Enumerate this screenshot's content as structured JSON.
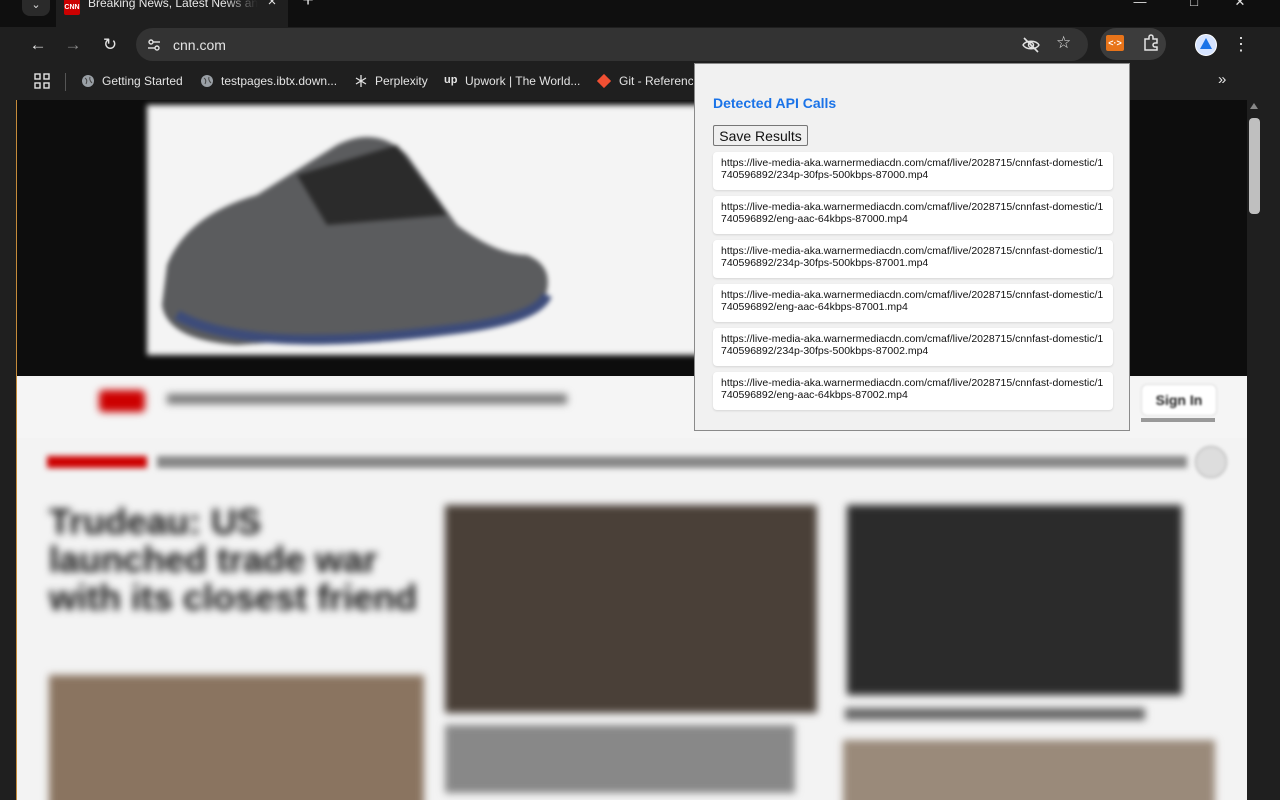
{
  "browser": {
    "tab": {
      "title": "Breaking News, Latest News and Videos | CNN",
      "favicon_text": "CNN"
    },
    "url": "cnn.com",
    "bookmarks": [
      {
        "label": "Getting Started",
        "icon": "globe-icon"
      },
      {
        "label": "testpages.ibtx.down...",
        "icon": "globe-icon"
      },
      {
        "label": "Perplexity",
        "icon": "perplexity-icon"
      },
      {
        "label": "Upwork | The World...",
        "icon": "upwork-icon"
      },
      {
        "label": "Git - Reference",
        "icon": "git-icon"
      }
    ],
    "extension_icon_text": "<·>",
    "accent_color": "#1a73e8"
  },
  "page": {
    "sign_in_label": "Sign In",
    "headline": "Trudeau: US launched trade war with its closest friend"
  },
  "popup": {
    "title": "Detected API Calls",
    "save_label": "Save Results",
    "api_calls": [
      "https://live-media-aka.warnermediacdn.com/cmaf/live/2028715/cnnfast-domestic/1740596892/234p-30fps-500kbps-87000.mp4",
      "https://live-media-aka.warnermediacdn.com/cmaf/live/2028715/cnnfast-domestic/1740596892/eng-aac-64kbps-87000.mp4",
      "https://live-media-aka.warnermediacdn.com/cmaf/live/2028715/cnnfast-domestic/1740596892/234p-30fps-500kbps-87001.mp4",
      "https://live-media-aka.warnermediacdn.com/cmaf/live/2028715/cnnfast-domestic/1740596892/eng-aac-64kbps-87001.mp4",
      "https://live-media-aka.warnermediacdn.com/cmaf/live/2028715/cnnfast-domestic/1740596892/234p-30fps-500kbps-87002.mp4",
      "https://live-media-aka.warnermediacdn.com/cmaf/live/2028715/cnnfast-domestic/1740596892/eng-aac-64kbps-87002.mp4"
    ]
  }
}
